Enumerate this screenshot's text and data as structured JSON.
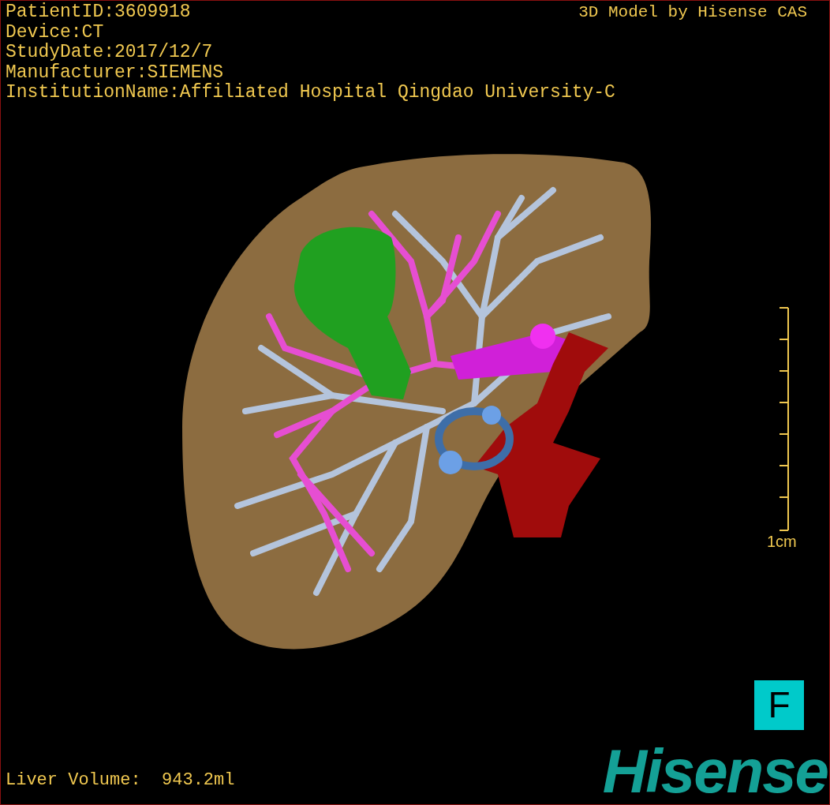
{
  "patient_info": [
    "PatientID:3609918",
    "Device:CT",
    "StudyDate:2017/12/7",
    "Manufacturer:SIEMENS",
    "InstitutionName:Affiliated Hospital Qingdao University-C"
  ],
  "model_credit": "3D Model by Hisense CAS",
  "scale_bar": {
    "label": "1cm"
  },
  "orientation_marker": "F",
  "liver_volume": {
    "label": "Liver Volume:",
    "value": "943.2ml"
  },
  "logo": "Hisense"
}
